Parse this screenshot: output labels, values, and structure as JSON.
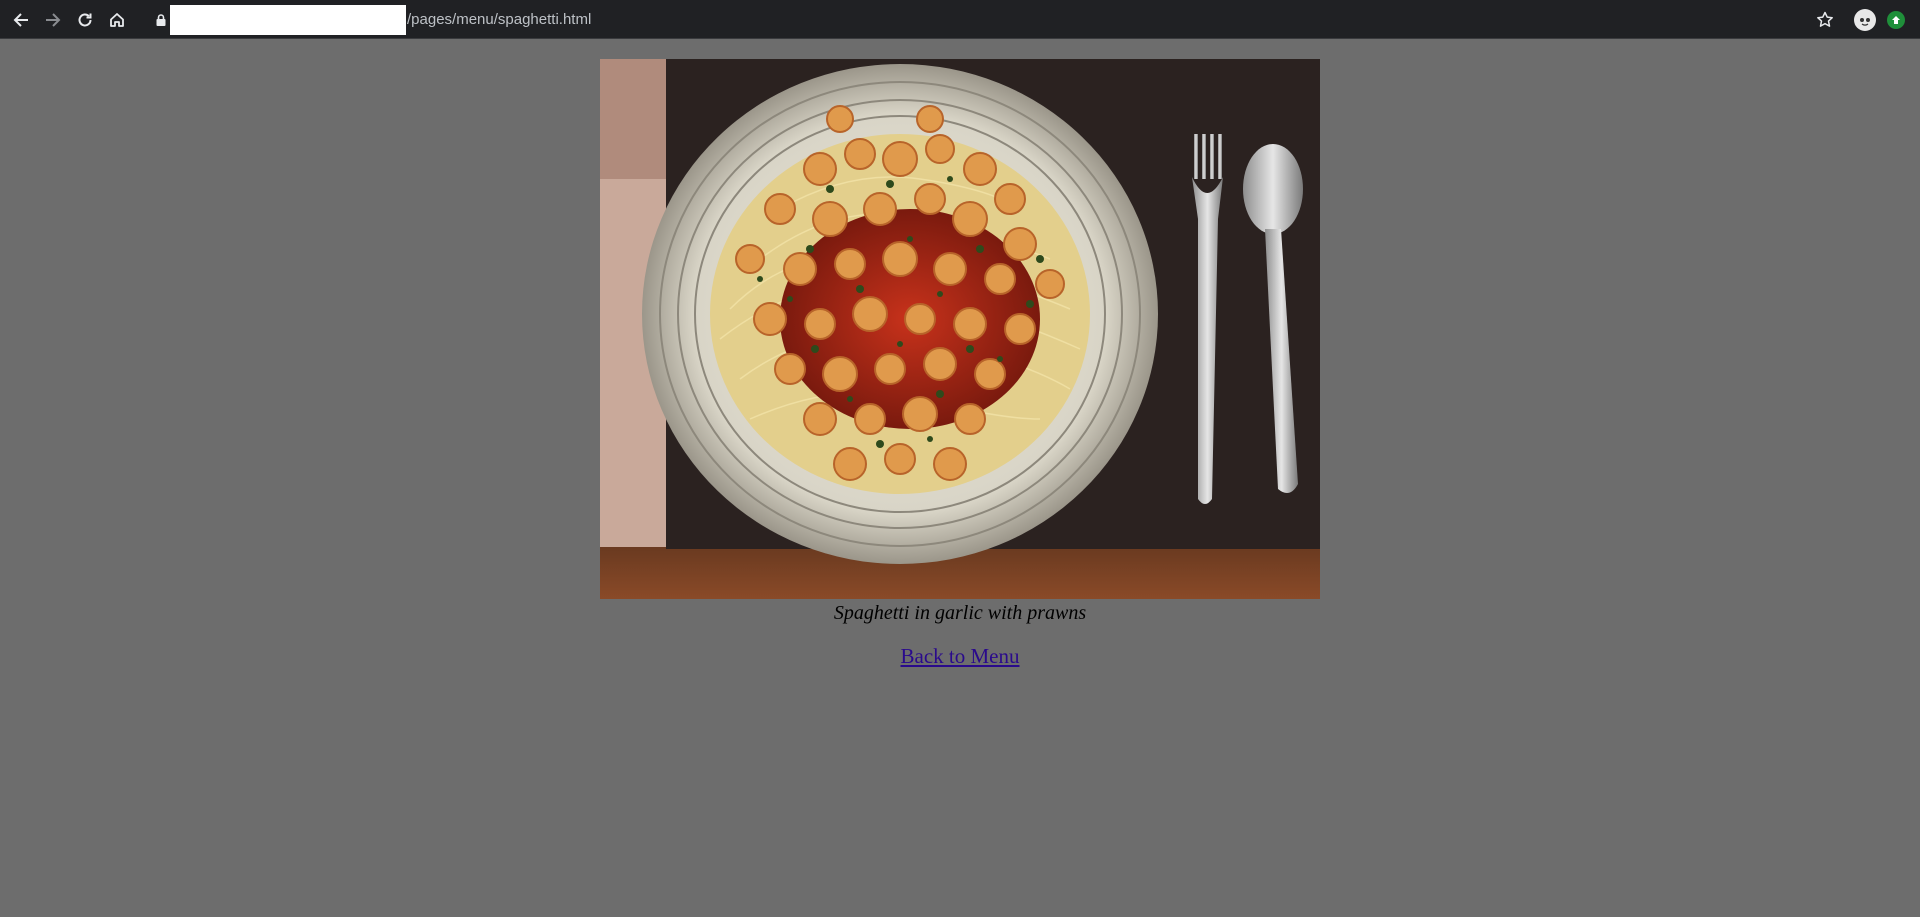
{
  "browser": {
    "url_path": "/pages/menu/spaghetti.html",
    "icons": [
      "back-icon",
      "forward-icon",
      "reload-icon",
      "home-icon",
      "lock-icon",
      "star-icon",
      "profile-avatar-icon",
      "extension-icon"
    ]
  },
  "page": {
    "background": "#6d6d6d",
    "image": {
      "description_icon": "dish-photo"
    },
    "caption": "Spaghetti in garlic with prawns",
    "back_link_label": "Back to Menu",
    "link_color": "#2a0a8c"
  }
}
